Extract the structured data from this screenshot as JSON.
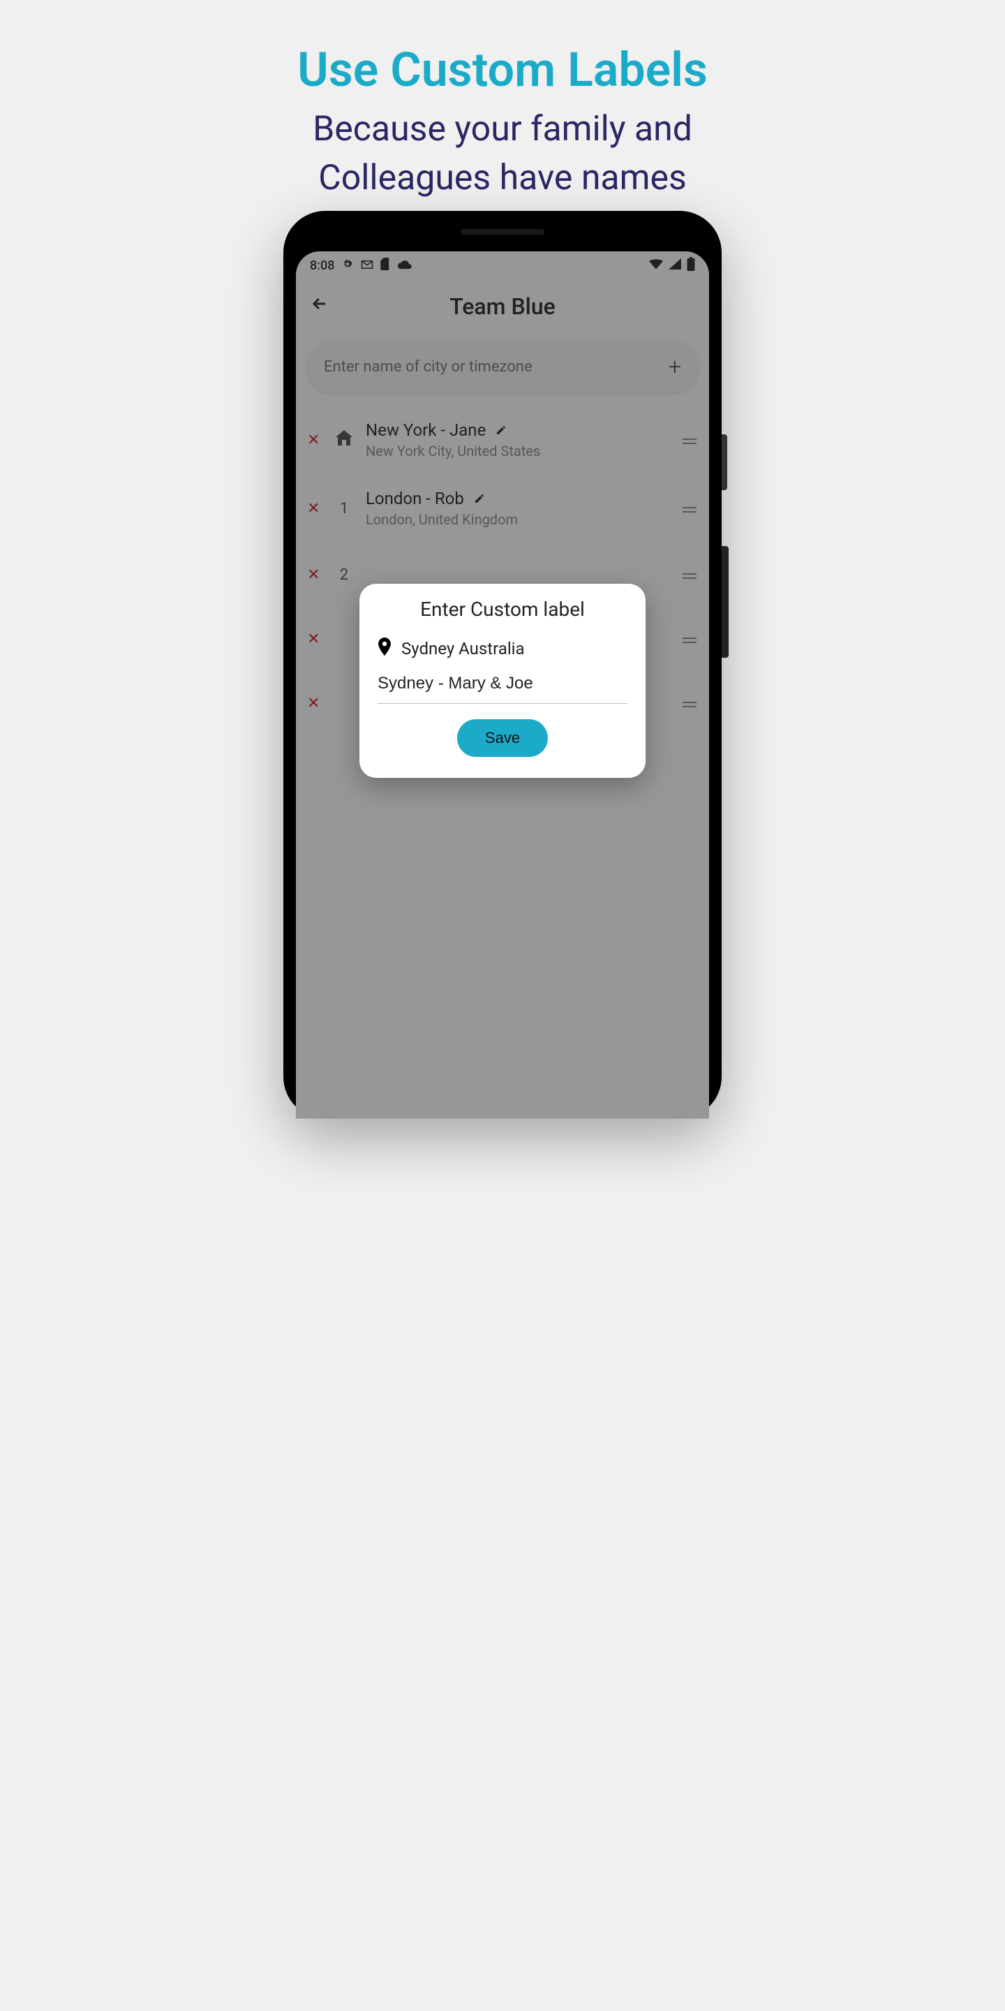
{
  "promo": {
    "title": "Use Custom Labels",
    "subtitle_line1": "Because your family and",
    "subtitle_line2": "Colleagues have names"
  },
  "statusbar": {
    "time": "8:08"
  },
  "header": {
    "title": "Team Blue"
  },
  "search": {
    "placeholder": "Enter name of city or timezone"
  },
  "cities": [
    {
      "label": "New York - Jane",
      "sublabel": "New York City, United States",
      "marker": "home"
    },
    {
      "label": "London - Rob",
      "sublabel": "London, United Kingdom",
      "marker": "1"
    },
    {
      "label": "",
      "sublabel": "",
      "marker": "2"
    },
    {
      "label": "",
      "sublabel": "",
      "marker": ""
    },
    {
      "label": "",
      "sublabel": "",
      "marker": ""
    }
  ],
  "dialog": {
    "title": "Enter Custom label",
    "location": "Sydney Australia",
    "input_value": "Sydney - Mary & Joe",
    "save_label": "Save"
  },
  "colors": {
    "accent": "#1babc8",
    "dark": "#2a2763"
  }
}
